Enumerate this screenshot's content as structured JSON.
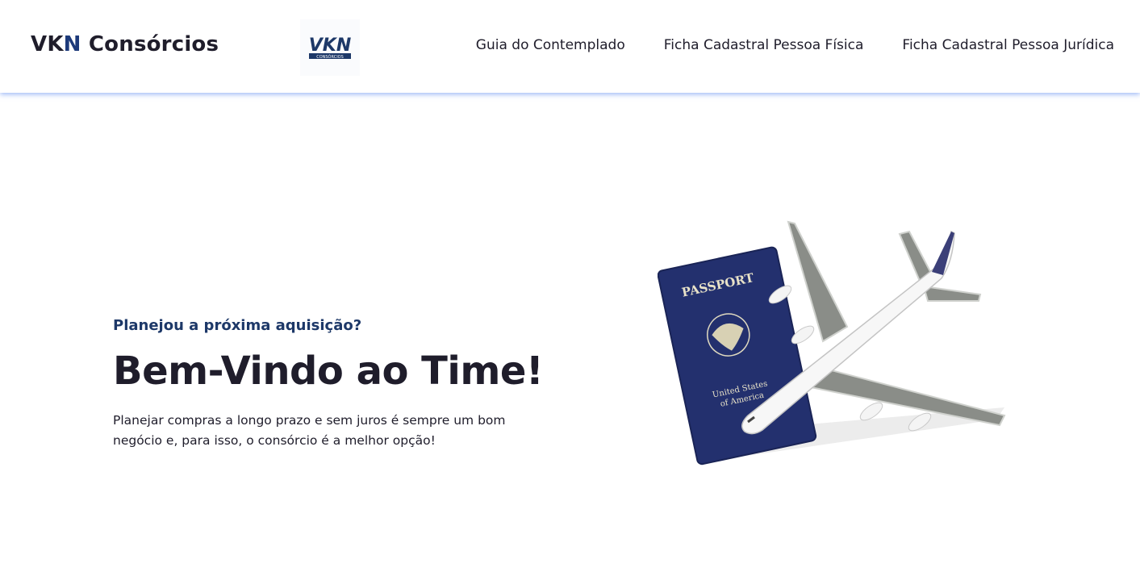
{
  "header": {
    "brand_prefix": "VK",
    "brand_accent": "N",
    "brand_suffix": " Consórcios",
    "logo_text": "VKN",
    "logo_subtext": "CONSÓRCIOS",
    "nav": [
      {
        "label": "Guia do Contemplado"
      },
      {
        "label": "Ficha Cadastral Pessoa Física"
      },
      {
        "label": "Ficha Cadastral Pessoa Jurídica"
      }
    ]
  },
  "hero": {
    "subtitle": "Planejou a próxima aquisição?",
    "title": "Bem-Vindo ao Time!",
    "text": "Planejar compras a longo prazo e sem juros é sempre um bom negócio e, para isso, o consórcio é a melhor opção!",
    "image": {
      "passport_title": "PASSPORT",
      "passport_country_line1": "United States",
      "passport_country_line2": "of America"
    }
  },
  "colors": {
    "navy": "#1d3868",
    "text": "#1f1d2b",
    "header_shadow": "#4d80ee",
    "passport": "#23306e"
  }
}
